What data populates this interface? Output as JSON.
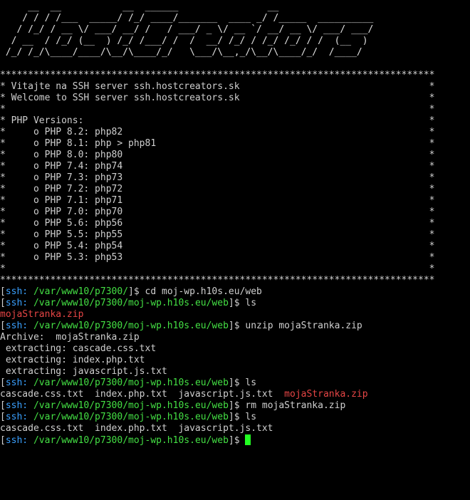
{
  "terminal": {
    "banner": [
      "     __  __           __  ______                __                      ",
      "    / / / /___  _____/ /_/ ____/_______  ____ _/ /_____  __________     ",
      "   / /_/ / __ \\/ ___/ __/ /   / ___/ _ \\/ __ `/ __/ __ \\/ ___/ ___/   ",
      "  / __  / /_/ (__  ) /_/ /___/ /  /  __/ /_/ / /_/ /_/ / /  (__  )      ",
      " /_/ /_/\\____/____/\\__/\\____/_/   \\___/\\__,_/\\__/\\____/_/  /____/  "
    ],
    "motd": [
      "******************************************************************************",
      "* Vitajte na SSH server ssh.hostcreators.sk                                  *",
      "* Welcome to SSH server ssh.hostcreators.sk                                  *",
      "*                                                                            *",
      "* PHP Versions:                                                              *",
      "*     o PHP 8.2: php82                                                       *",
      "*     o PHP 8.1: php > php81                                                 *",
      "*     o PHP 8.0: php80                                                       *",
      "*     o PHP 7.4: php74                                                       *",
      "*     o PHP 7.3: php73                                                       *",
      "*     o PHP 7.2: php72                                                       *",
      "*     o PHP 7.1: php71                                                       *",
      "*     o PHP 7.0: php70                                                       *",
      "*     o PHP 5.6: php56                                                       *",
      "*     o PHP 5.5: php55                                                       *",
      "*     o PHP 5.4: php54                                                       *",
      "*     o PHP 5.3: php53                                                       *",
      "*                                                                            *",
      "******************************************************************************"
    ],
    "prompt_host": "ssh:",
    "path_home": "/var/www10/p7300/",
    "path_web": "/var/www10/p7300/moj-wp.h10s.eu/web",
    "prompt_open": "[",
    "prompt_close": "]$ ",
    "cmd_cd": "cd moj-wp.h10s.eu/web",
    "cmd_ls": "ls",
    "cmd_unzip": "unzip mojaStranka.zip",
    "cmd_rm": "rm mojaStranka.zip",
    "zip_file": "mojaStranka.zip",
    "archive_line": "Archive:  mojaStranka.zip",
    "extract_lines": [
      " extracting: cascade.css.txt",
      " extracting: index.php.txt",
      " extracting: javascript.js.txt"
    ],
    "files_listing": "cascade.css.txt  index.php.txt  javascript.js.txt",
    "files_listing_gap": "  ",
    "colors": {
      "background": "#000000",
      "host": "#3aa0ff",
      "path": "#44e044",
      "archive_file": "#e64545",
      "cursor": "#22ff22"
    }
  }
}
